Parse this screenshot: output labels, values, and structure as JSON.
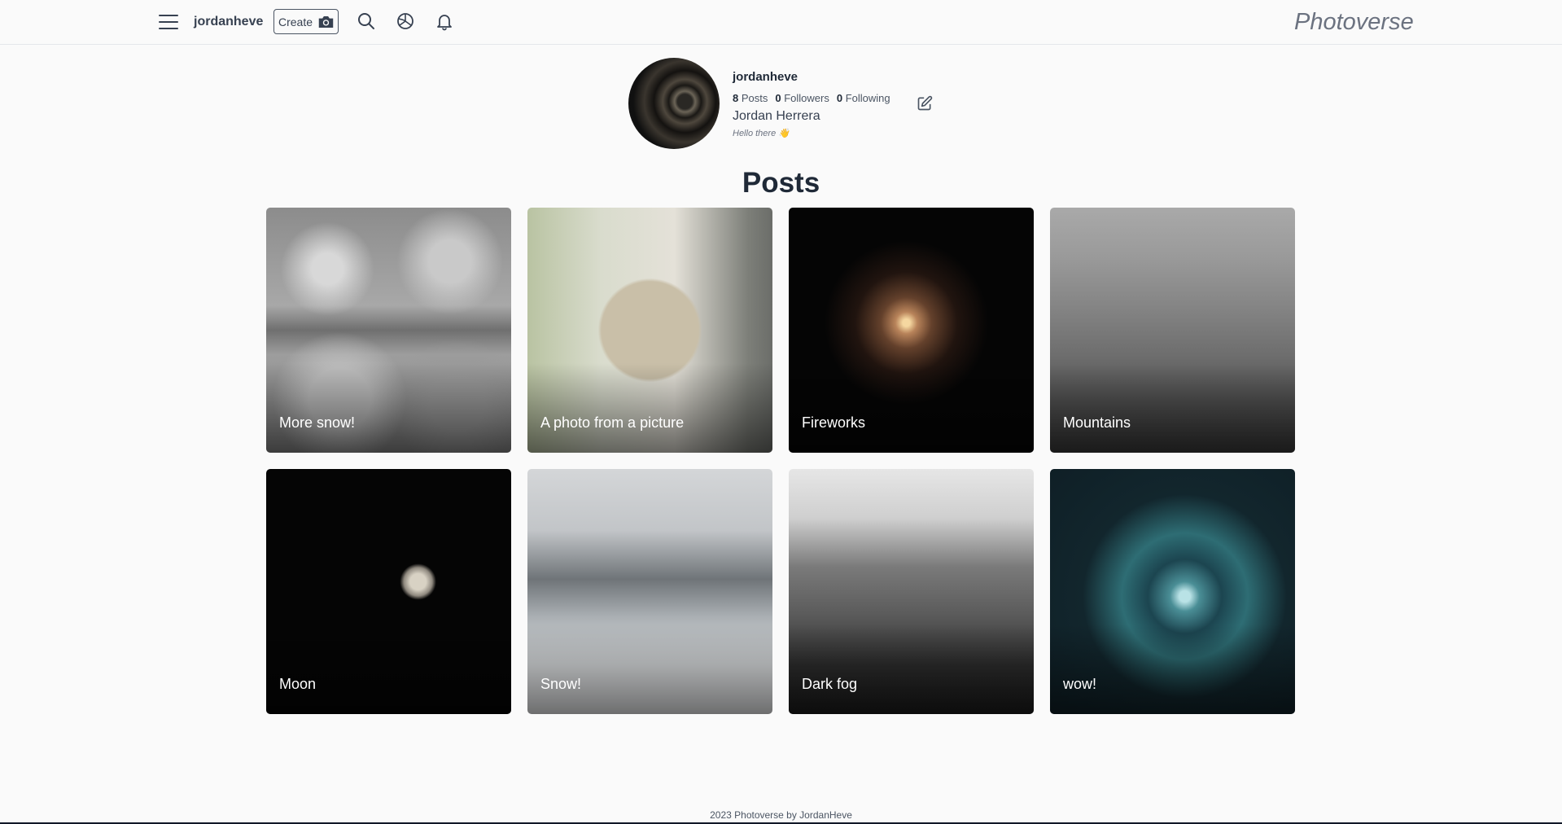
{
  "nav": {
    "username": "jordanheve",
    "create_label": "Create",
    "icons": [
      "menu-icon",
      "camera-icon",
      "search-icon",
      "explore-icon",
      "bell-icon"
    ],
    "brand": "Photoverse"
  },
  "profile": {
    "username": "jordanheve",
    "posts_count": "8",
    "posts_label": "Posts",
    "followers_count": "0",
    "followers_label": "Followers",
    "following_count": "0",
    "following_label": "Following",
    "full_name": "Jordan Herrera",
    "bio": "Hello there 👋"
  },
  "section_title": "Posts",
  "posts": [
    {
      "caption": "More snow!"
    },
    {
      "caption": "A photo from a picture"
    },
    {
      "caption": "Fireworks"
    },
    {
      "caption": "Mountains"
    },
    {
      "caption": "Moon"
    },
    {
      "caption": "Snow!"
    },
    {
      "caption": "Dark fog"
    },
    {
      "caption": "wow!"
    }
  ],
  "footer": "2023 Photoverse by JordanHeve"
}
